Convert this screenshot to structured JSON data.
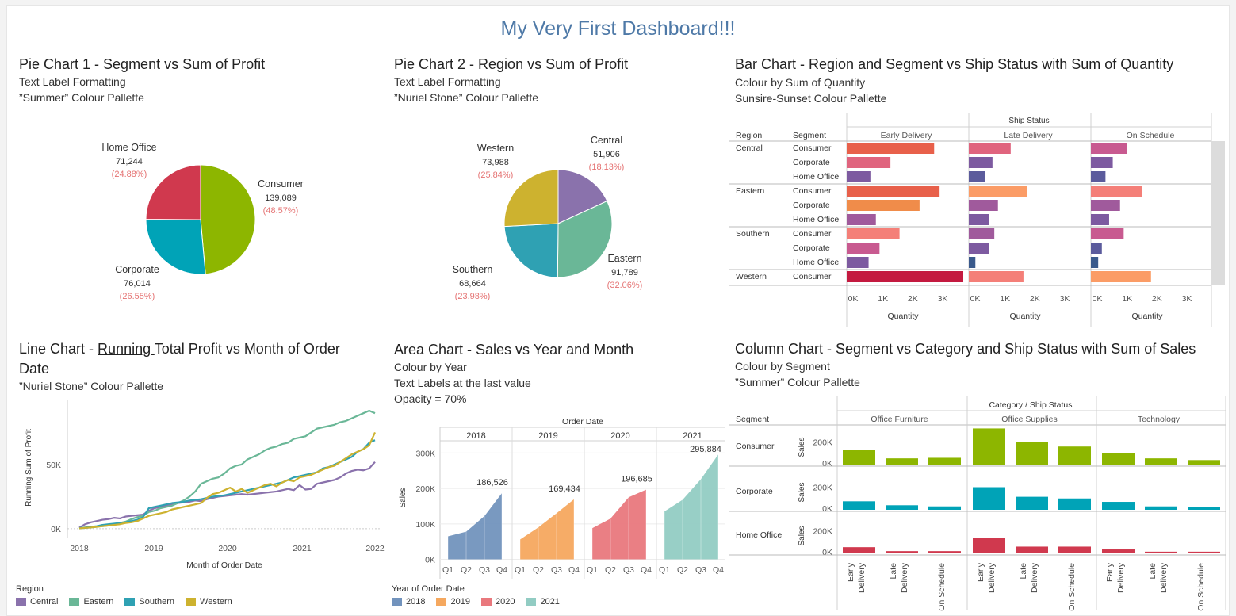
{
  "dashboard_title": "My Very First Dashboard!!!",
  "colors": {
    "region": {
      "Central": "#8a72ac",
      "Eastern": "#6ab797",
      "Southern": "#2fa1b3",
      "Western": "#cdb22f"
    },
    "year": {
      "2018": "#7293bd",
      "2019": "#f5a85f",
      "2020": "#e9787d",
      "2021": "#92ccc3"
    },
    "segment": {
      "Consumer": "#8db600",
      "Corporate": "#00a3b7",
      "Home Office": "#d0394e"
    },
    "pct": "#e57373"
  },
  "pie1": {
    "title": "Pie Chart 1 - Segment vs Sum of Profit",
    "subtitle1": "Text Label Formatting",
    "subtitle2": "”Summer” Colour Pallette"
  },
  "pie2": {
    "title": "Pie Chart 2 - Region vs Sum of Profit",
    "subtitle1": "Text Label Formatting",
    "subtitle2": "”Nuriel Stone” Colour Pallette"
  },
  "bar": {
    "title": "Bar Chart - Region and Segment vs Ship Status with Sum of Quantity",
    "subtitle1": "Colour by Sum of Quantity",
    "subtitle2": "Sunsire-Sunset Colour Pallette"
  },
  "line": {
    "title_part1": "Line Chart - ",
    "title_underlined": "Running ",
    "title_part2": "Total Profit vs Month of Order",
    "title_line2": "Date",
    "subtitle1": "”Nuriel Stone” Colour Pallette",
    "legend_title": "Region",
    "legend": [
      "Central",
      "Eastern",
      "Southern",
      "Western"
    ]
  },
  "area": {
    "title": "Area Chart - Sales vs Year and Month",
    "subtitle1": "Colour by Year",
    "subtitle2": "Text Labels at the last value",
    "subtitle3": "Opacity = 70%",
    "legend_title": "Year of Order Date",
    "legend": [
      "2018",
      "2019",
      "2020",
      "2021"
    ]
  },
  "column": {
    "title": "Column Chart - Segment vs Category and Ship Status with Sum of Sales",
    "subtitle1": "Colour by Segment",
    "subtitle2": "”Summer” Colour Pallette"
  },
  "chart_data": [
    {
      "id": "pie1",
      "type": "pie",
      "slices": [
        {
          "label": "Consumer",
          "value": 139089,
          "display": "139,089",
          "pct": "(48.57%)",
          "color": "#8db600"
        },
        {
          "label": "Corporate",
          "value": 76014,
          "display": "76,014",
          "pct": "(26.55%)",
          "color": "#00a3b7"
        },
        {
          "label": "Home Office",
          "value": 71244,
          "display": "71,244",
          "pct": "(24.88%)",
          "color": "#d0394e"
        }
      ]
    },
    {
      "id": "pie2",
      "type": "pie",
      "slices": [
        {
          "label": "Central",
          "value": 51906,
          "display": "51,906",
          "pct": "(18.13%)",
          "color": "#8a72ac"
        },
        {
          "label": "Eastern",
          "value": 91789,
          "display": "91,789",
          "pct": "(32.06%)",
          "color": "#6ab797"
        },
        {
          "label": "Southern",
          "value": 68664,
          "display": "68,664",
          "pct": "(23.98%)",
          "color": "#2fa1b3"
        },
        {
          "label": "Western",
          "value": 73988,
          "display": "73,988",
          "pct": "(25.84%)",
          "color": "#cdb22f"
        }
      ]
    },
    {
      "id": "bar",
      "type": "bar",
      "header": "Ship Status",
      "row_header_1": "Region",
      "row_header_2": "Segment",
      "columns": [
        "Early Delivery",
        "Late Delivery",
        "On Schedule"
      ],
      "xlim": [
        0,
        3600
      ],
      "ticks": [
        0,
        1000,
        2000,
        3000
      ],
      "tick_labels": [
        "0K",
        "1K",
        "2K",
        "3K"
      ],
      "xlabel": "Quantity",
      "rows": [
        {
          "region": "Central",
          "segment": "Consumer",
          "values": [
            2400,
            1150,
            1000
          ]
        },
        {
          "region": "",
          "segment": "Corporate",
          "values": [
            1200,
            650,
            600
          ]
        },
        {
          "region": "",
          "segment": "Home Office",
          "values": [
            650,
            450,
            400
          ]
        },
        {
          "region": "Eastern",
          "segment": "Consumer",
          "values": [
            2550,
            1600,
            1400
          ]
        },
        {
          "region": "",
          "segment": "Corporate",
          "values": [
            2000,
            800,
            800
          ]
        },
        {
          "region": "",
          "segment": "Home Office",
          "values": [
            800,
            550,
            500
          ]
        },
        {
          "region": "Southern",
          "segment": "Consumer",
          "values": [
            1450,
            700,
            900
          ]
        },
        {
          "region": "",
          "segment": "Corporate",
          "values": [
            900,
            550,
            300
          ]
        },
        {
          "region": "",
          "segment": "Home Office",
          "values": [
            600,
            180,
            200
          ]
        },
        {
          "region": "Western",
          "segment": "Consumer",
          "values": [
            3200,
            1500,
            1650
          ]
        }
      ]
    },
    {
      "id": "line",
      "type": "line",
      "xlabel": "Month of Order Date",
      "ylabel": "Running Sum of Profit",
      "x_tick_labels": [
        "2018",
        "2019",
        "2020",
        "2021",
        "2022"
      ],
      "y_tick_labels": [
        "0K",
        "50K"
      ],
      "ylim": [
        -5000,
        100000
      ],
      "series": [
        {
          "name": "Central",
          "color": "#8a72ac",
          "values": [
            800,
            3500,
            5000,
            6000,
            7000,
            7500,
            8500,
            8000,
            9500,
            10000,
            10500,
            11000,
            14000,
            16000,
            17000,
            18000,
            19000,
            20000,
            20500,
            21000,
            22000,
            21500,
            23000,
            24000,
            25000,
            25500,
            26000,
            26500,
            27000,
            26500,
            27000,
            27500,
            28000,
            28500,
            29000,
            30000,
            31000,
            30000,
            34000,
            30500,
            31000,
            35000,
            36000,
            37000,
            38000,
            40000,
            43000,
            45000,
            46000,
            45500,
            47000,
            52000
          ]
        },
        {
          "name": "Eastern",
          "color": "#6ab797",
          "values": [
            200,
            600,
            900,
            1500,
            2000,
            2500,
            3500,
            4500,
            5500,
            7500,
            9000,
            10000,
            13000,
            14000,
            16000,
            17000,
            18000,
            20000,
            22000,
            25000,
            29000,
            35000,
            37000,
            39000,
            40000,
            43000,
            47000,
            49000,
            50000,
            54000,
            56000,
            58000,
            61000,
            63000,
            64000,
            66000,
            67000,
            70000,
            71000,
            72000,
            75000,
            78000,
            79000,
            80000,
            81000,
            83000,
            84000,
            86000,
            88000,
            90000,
            92000,
            90000
          ]
        },
        {
          "name": "Southern",
          "color": "#2fa1b3",
          "values": [
            500,
            1000,
            1500,
            2000,
            3000,
            3500,
            4000,
            4500,
            5000,
            6000,
            7000,
            9000,
            16000,
            17000,
            18000,
            19000,
            20000,
            20500,
            21000,
            22000,
            22500,
            23000,
            24000,
            25000,
            25500,
            26000,
            27000,
            28000,
            29000,
            30000,
            31000,
            32000,
            33000,
            34000,
            35000,
            36000,
            38000,
            40000,
            41000,
            42000,
            43000,
            44000,
            47000,
            48000,
            50000,
            52000,
            54000,
            56000,
            60000,
            62000,
            67000,
            69000
          ]
        },
        {
          "name": "Western",
          "color": "#cdb22f",
          "values": [
            300,
            700,
            1000,
            1500,
            2000,
            2500,
            3000,
            3500,
            4500,
            5000,
            6000,
            8000,
            10000,
            11000,
            12000,
            13000,
            15000,
            16000,
            17000,
            18000,
            19000,
            20000,
            24000,
            27000,
            28000,
            30000,
            32000,
            29000,
            31000,
            28000,
            30000,
            32000,
            34000,
            35000,
            33000,
            36000,
            38000,
            37000,
            40000,
            41000,
            42000,
            44000,
            46000,
            48000,
            49000,
            52000,
            55000,
            58000,
            60000,
            62000,
            65000,
            75000
          ]
        }
      ]
    },
    {
      "id": "area",
      "type": "area",
      "header": "Order Date",
      "years": [
        "2018",
        "2019",
        "2020",
        "2021"
      ],
      "quarters": [
        "Q1",
        "Q2",
        "Q3",
        "Q4"
      ],
      "ylabel": "Sales",
      "y_ticks": [
        0,
        100000,
        200000,
        300000
      ],
      "y_tick_labels": [
        "0K",
        "100K",
        "200K",
        "300K"
      ],
      "ylim": [
        -10000,
        330000
      ],
      "series": [
        {
          "name": "2018",
          "values": [
            65000,
            78000,
            122000,
            186526
          ],
          "label": "186,526",
          "color": "#7293bd"
        },
        {
          "name": "2019",
          "values": [
            56000,
            90000,
            130000,
            169434
          ],
          "label": "169,434",
          "color": "#f5a85f"
        },
        {
          "name": "2020",
          "values": [
            88000,
            115000,
            175000,
            196685
          ],
          "label": "196,685",
          "color": "#e9787d"
        },
        {
          "name": "2021",
          "values": [
            135000,
            168000,
            226000,
            295884
          ],
          "label": "295,884",
          "color": "#92ccc3"
        }
      ]
    },
    {
      "id": "column",
      "type": "bar",
      "header": "Category / Ship Status",
      "row_header": "Segment",
      "categories": [
        "Office Furniture",
        "Office Supplies",
        "Technology"
      ],
      "statuses": [
        [
          "Early",
          "Delivery"
        ],
        [
          "Late",
          "Delivery"
        ],
        [
          "On Schedule"
        ]
      ],
      "ylabel": "Sales",
      "y_tick_labels": [
        "0K",
        "200K"
      ],
      "ylim": [
        0,
        330000
      ],
      "segments": [
        {
          "name": "Consumer",
          "color": "#8db600",
          "values": [
            [
              130000,
              55000,
              60000
            ],
            [
              320000,
              200000,
              160000
            ],
            [
              105000,
              55000,
              40000
            ]
          ]
        },
        {
          "name": "Corporate",
          "color": "#00a3b7",
          "values": [
            [
              75000,
              40000,
              30000
            ],
            [
              200000,
              115000,
              100000
            ],
            [
              70000,
              30000,
              25000
            ]
          ]
        },
        {
          "name": "Home Office",
          "color": "#d0394e",
          "values": [
            [
              55000,
              20000,
              20000
            ],
            [
              140000,
              60000,
              60000
            ],
            [
              35000,
              15000,
              15000
            ]
          ]
        }
      ]
    }
  ]
}
